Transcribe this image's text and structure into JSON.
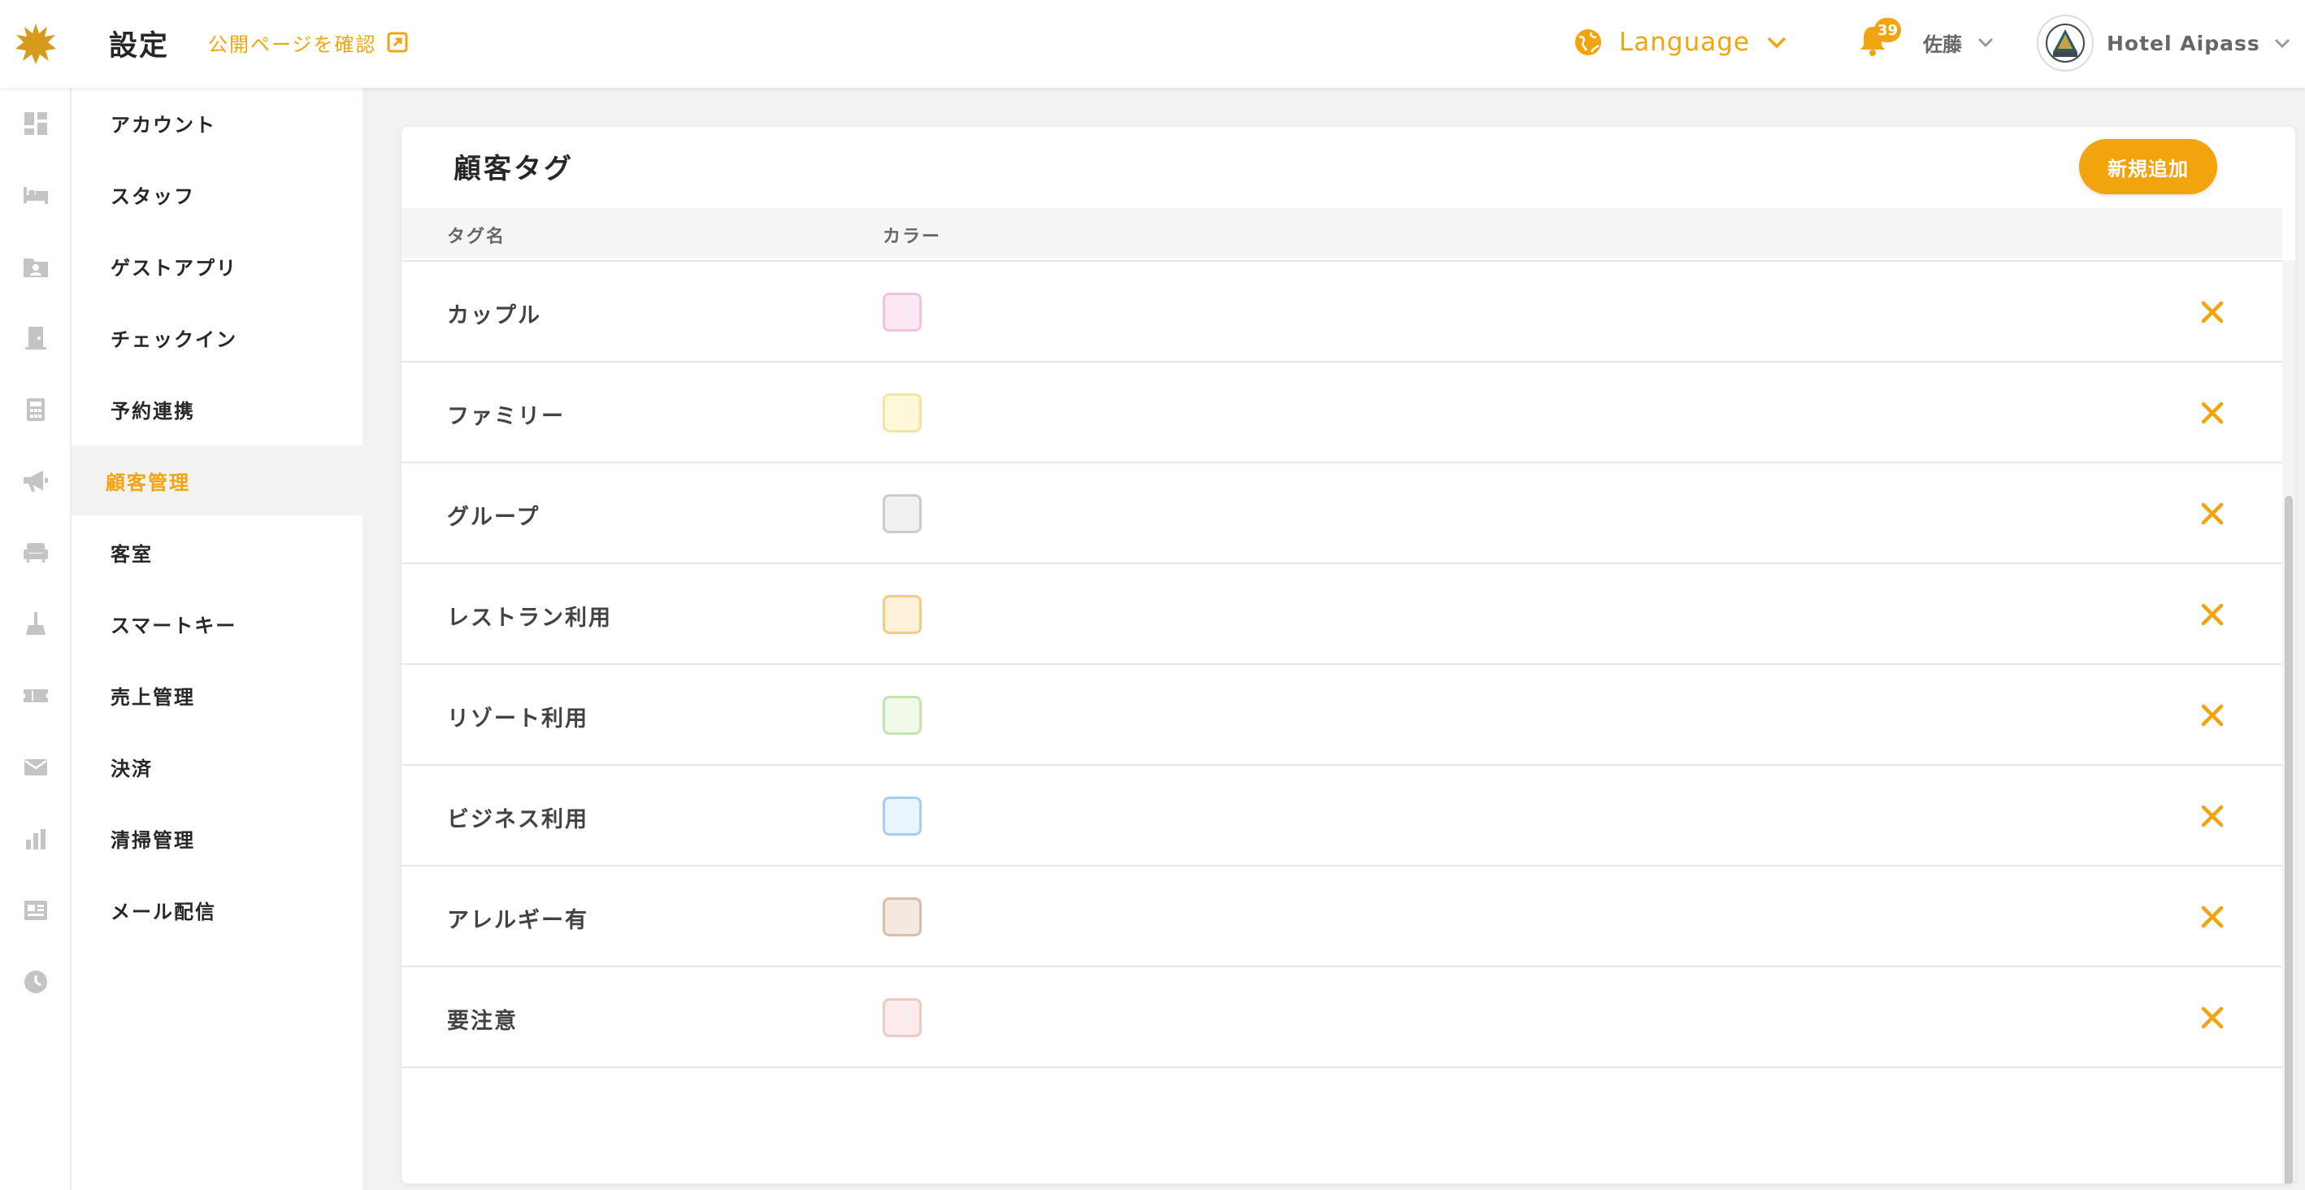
{
  "header": {
    "title": "設定",
    "public_page_link": "公開ページを確認",
    "language_label": "Language",
    "notification_count": "39",
    "user_name": "佐藤",
    "hotel_name": "Hotel Aipass",
    "accent_color": "#f2a40e"
  },
  "rail": {
    "icons": [
      "dashboard-icon",
      "bed-icon",
      "guest-folder-icon",
      "door-icon",
      "calculator-icon",
      "megaphone-icon",
      "sofa-icon",
      "cleaning-icon",
      "ticket-icon",
      "mail-icon",
      "bar-chart-icon",
      "news-icon",
      "clock-icon"
    ]
  },
  "sidebar": {
    "items": [
      {
        "label": "アカウント"
      },
      {
        "label": "スタッフ"
      },
      {
        "label": "ゲストアプリ"
      },
      {
        "label": "チェックイン"
      },
      {
        "label": "予約連携"
      },
      {
        "label": "顧客管理",
        "active": true
      },
      {
        "label": "客室"
      },
      {
        "label": "スマートキー"
      },
      {
        "label": "売上管理"
      },
      {
        "label": "決済"
      },
      {
        "label": "清掃管理"
      },
      {
        "label": "メール配信"
      }
    ]
  },
  "main": {
    "title": "顧客タグ",
    "add_button": "新規追加",
    "columns": [
      "タグ名",
      "カラー"
    ],
    "rows": [
      {
        "name": "カップル",
        "bg": "#fce8f5",
        "border": "#f1c3e2"
      },
      {
        "name": "ファミリー",
        "bg": "#fdf9d8",
        "border": "#f0e6a2"
      },
      {
        "name": "グループ",
        "bg": "#f0f0f0",
        "border": "#cccccc"
      },
      {
        "name": "レストラン利用",
        "bg": "#fdf1d9",
        "border": "#f3cc84"
      },
      {
        "name": "リゾート利用",
        "bg": "#f1f9ea",
        "border": "#c6e3ad"
      },
      {
        "name": "ビジネス利用",
        "bg": "#eaf4fd",
        "border": "#a9cdef"
      },
      {
        "name": "アレルギー有",
        "bg": "#f4e8e1",
        "border": "#d9bdad"
      },
      {
        "name": "要注意",
        "bg": "#fbeceb",
        "border": "#f0c8c4"
      }
    ]
  }
}
